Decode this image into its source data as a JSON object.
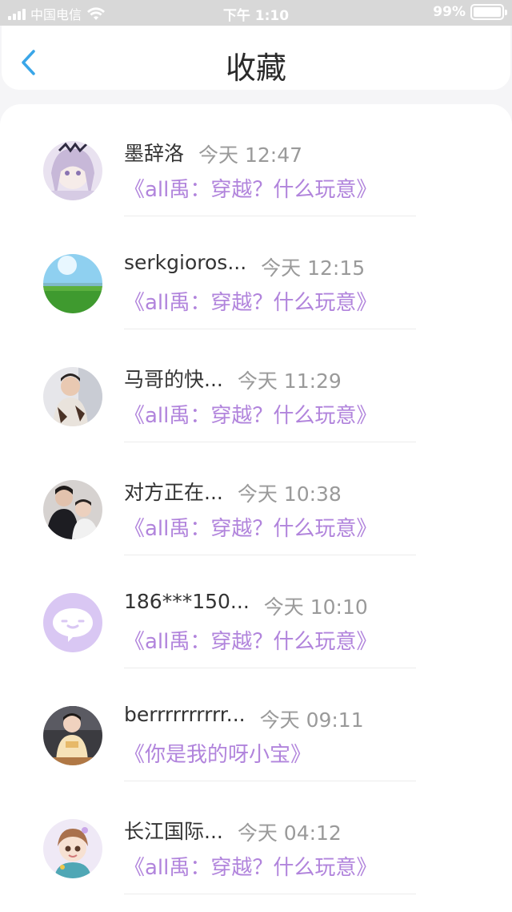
{
  "status_bar": {
    "carrier": "中国电信",
    "time": "下午 1:10",
    "battery": "99%",
    "battery_level": 0.99
  },
  "nav": {
    "back_icon": "chevron-left-icon",
    "title": "收藏"
  },
  "favorites": [
    {
      "name": "墨辞洛",
      "time": "今天 12:47",
      "title": "《all禹：穿越？什么玩意》",
      "avatar": "anime-girl-avatar"
    },
    {
      "name": "serkgioros...",
      "time": "今天 12:15",
      "title": "《all禹：穿越？什么玩意》",
      "avatar": "landscape-avatar"
    },
    {
      "name": "马哥的快...",
      "time": "今天 11:29",
      "title": "《all禹：穿越？什么玩意》",
      "avatar": "person-photo-avatar"
    },
    {
      "name": "对方正在...",
      "time": "今天 10:38",
      "title": "《all禹：穿越？什么玩意》",
      "avatar": "couple-photo-avatar"
    },
    {
      "name": "186***150...",
      "time": "今天 10:10",
      "title": "《all禹：穿越？什么玩意》",
      "avatar": "default-chat-avatar"
    },
    {
      "name": "berrrrrrrrrr...",
      "time": "今天 09:11",
      "title": "《你是我的呀小宝》",
      "avatar": "child-photo-avatar"
    },
    {
      "name": "长江国际...",
      "time": "今天 04:12",
      "title": "《all禹：穿越？什么玩意》",
      "avatar": "cartoon-boy-avatar"
    }
  ],
  "colors": {
    "accent": "#3aa6e8",
    "title_purple": "#b184dc",
    "time_gray": "#9a9a9a",
    "default_avatar_bg": "#d9c7f3"
  }
}
